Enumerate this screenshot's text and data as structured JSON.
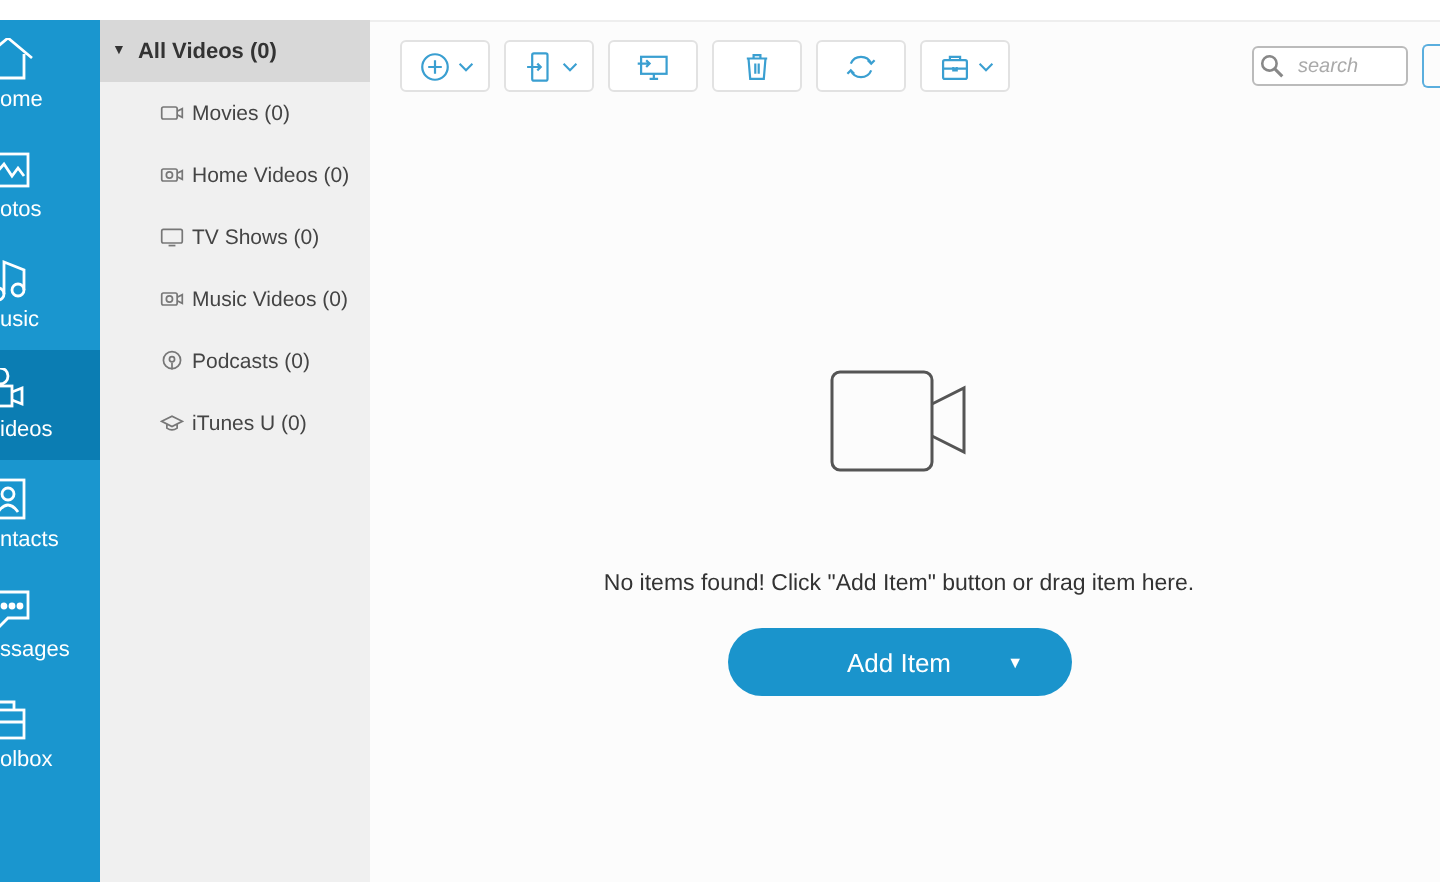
{
  "nav": [
    {
      "label": "ome",
      "kind": "home",
      "selected": false
    },
    {
      "label": "otos",
      "kind": "photos",
      "selected": false
    },
    {
      "label": "usic",
      "kind": "music",
      "selected": false
    },
    {
      "label": "ideos",
      "kind": "videos",
      "selected": true
    },
    {
      "label": "ntacts",
      "kind": "contacts",
      "selected": false
    },
    {
      "label": "ssages",
      "kind": "messages",
      "selected": false
    },
    {
      "label": "olbox",
      "kind": "toolbox",
      "selected": false
    }
  ],
  "categories": {
    "header": {
      "caret": "▼",
      "label": "All Videos (0)",
      "expanded": true
    },
    "children": [
      {
        "label": "Movies (0)",
        "kind": "movies"
      },
      {
        "label": "Home Videos (0)",
        "kind": "home"
      },
      {
        "label": "TV Shows (0)",
        "kind": "tv"
      },
      {
        "label": "Music Videos (0)",
        "kind": "music"
      },
      {
        "label": "Podcasts (0)",
        "kind": "podcasts"
      },
      {
        "label": "iTunes U (0)",
        "kind": "itunesu"
      }
    ]
  },
  "toolbar": [
    {
      "kind": "add",
      "dropdown": true
    },
    {
      "kind": "export",
      "dropdown": true
    },
    {
      "kind": "to-pc",
      "dropdown": false
    },
    {
      "kind": "delete",
      "dropdown": false
    },
    {
      "kind": "refresh",
      "dropdown": false
    },
    {
      "kind": "toolbox",
      "dropdown": true
    }
  ],
  "search": {
    "placeholder": "search"
  },
  "empty": {
    "message": "No items found! Click \"Add Item\" button or drag item here.",
    "button": "Add Item",
    "caret": "▼"
  }
}
